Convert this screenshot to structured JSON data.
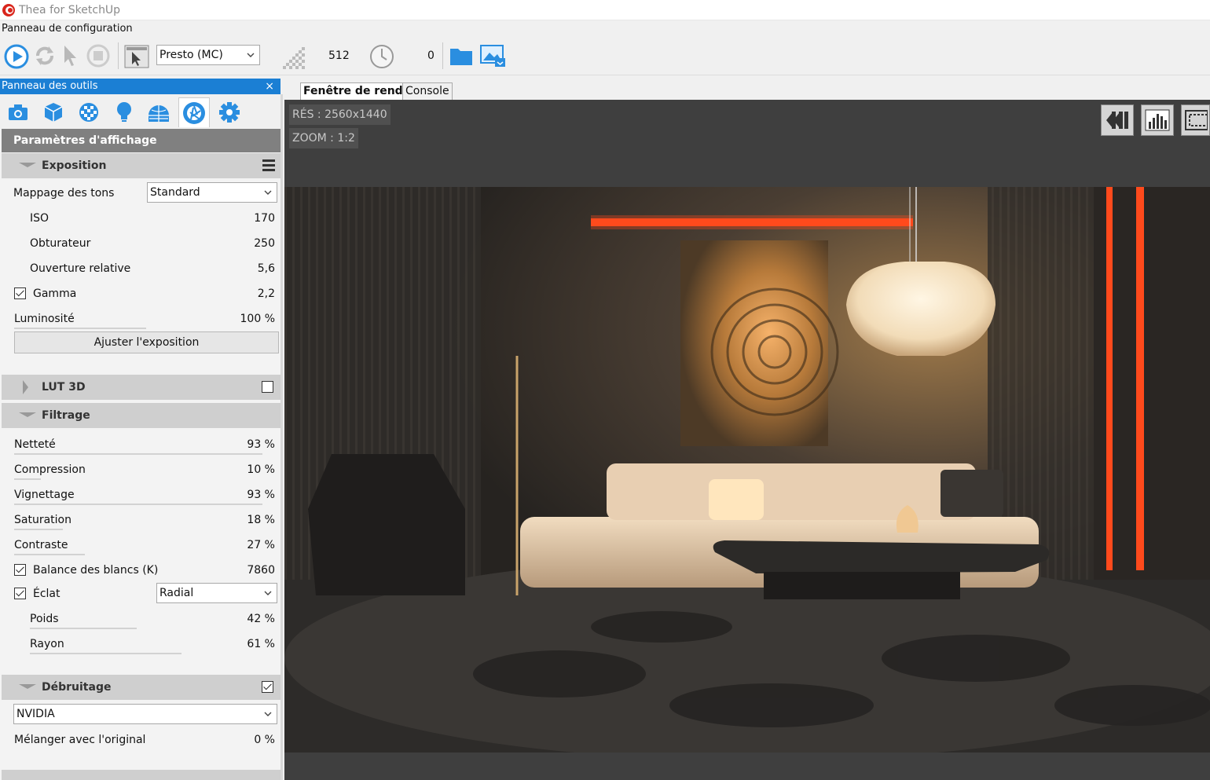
{
  "window": {
    "title": "Thea for SketchUp"
  },
  "panel_bar": {
    "label": "Panneau de configuration"
  },
  "toolbar": {
    "engine_mode": "Presto (MC)",
    "sample_count": "512",
    "time_value": "0"
  },
  "tool_panel": {
    "title": "Panneau des outils",
    "close": "×",
    "section_title": "Paramètres d'affichage",
    "exposure": {
      "title": "Exposition",
      "tone_mapping_label": "Mappage des tons",
      "tone_mapping_value": "Standard",
      "iso_label": "ISO",
      "iso_value": "170",
      "shutter_label": "Obturateur",
      "shutter_value": "250",
      "fstop_label": "Ouverture relative",
      "fstop_value": "5,6",
      "gamma_label": "Gamma",
      "gamma_value": "2,2",
      "gamma_checked": true,
      "brightness_label": "Luminosité",
      "brightness_value": "100 %",
      "adjust_button": "Ajuster l'exposition"
    },
    "lut": {
      "title": "LUT 3D",
      "checked": false
    },
    "filtering": {
      "title": "Filtrage",
      "sharpness_label": "Netteté",
      "sharpness_value": "93 %",
      "compression_label": "Compression",
      "compression_value": "10 %",
      "vignetting_label": "Vignettage",
      "vignetting_value": "93 %",
      "saturation_label": "Saturation",
      "saturation_value": "18 %",
      "contrast_label": "Contraste",
      "contrast_value": "27 %",
      "wb_label": "Balance des blancs (K)",
      "wb_value": "7860",
      "wb_checked": true,
      "bloom_label": "Éclat",
      "bloom_type": "Radial",
      "bloom_checked": true,
      "weight_label": "Poids",
      "weight_value": "42 %",
      "radius_label": "Rayon",
      "radius_value": "61 %"
    },
    "denoise": {
      "title": "Débruitage",
      "checked": true,
      "engine": "NVIDIA",
      "blend_label": "Mélanger avec l'original",
      "blend_value": "0 %"
    }
  },
  "render_window": {
    "tabs": [
      "Fenêtre de rendu",
      "Console"
    ],
    "resolution": "RÉS : 2560x1440",
    "zoom": "ZOOM : 1:2"
  },
  "colors": {
    "accent": "#1b7fd4",
    "icon_blue": "#2a8ee0",
    "neon": "#ff4a1c"
  }
}
